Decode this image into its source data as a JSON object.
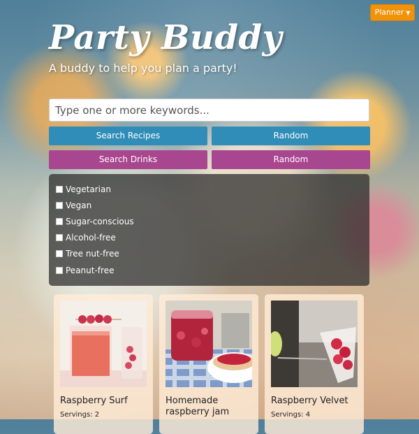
{
  "header": {
    "planner_label": "Planner",
    "title": "Party Buddy",
    "subtitle": "A buddy to help you plan a party!"
  },
  "search": {
    "placeholder": "Type one or more keywords..."
  },
  "buttons": {
    "search_recipes": "Search Recipes",
    "random_recipes": "Random",
    "search_drinks": "Search Drinks",
    "random_drinks": "Random"
  },
  "filters": [
    "Vegetarian",
    "Vegan",
    "Sugar-conscious",
    "Alcohol-free",
    "Tree nut-free",
    "Peanut-free"
  ],
  "cards": [
    {
      "title": "Raspberry Surf",
      "servings": "Servings: 2"
    },
    {
      "title": "Homemade raspberry jam",
      "servings": ""
    },
    {
      "title": "Raspberry Velvet",
      "servings": "Servings: 4"
    }
  ],
  "colors": {
    "accent_orange": "#f0930a",
    "button_blue": "#2f8db8",
    "button_purple": "#a8468f"
  }
}
